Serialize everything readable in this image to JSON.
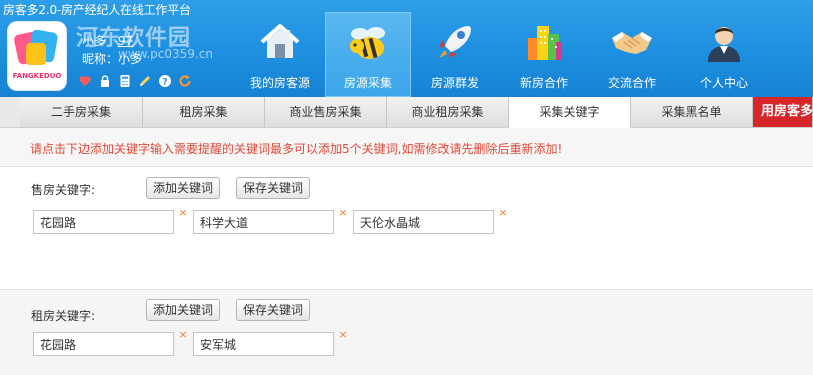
{
  "window_title": "房客多2.0-房产经纪人在线工作平台",
  "logo_text": "FANGKEDUO",
  "watermark": "河东软件园",
  "watermark_url": "www.pc0359.cn",
  "user": {
    "name": "小多",
    "id_link": "97",
    "nickname_label": "昵称：",
    "nickname": "小多"
  },
  "mini_icons": [
    "heart-icon",
    "lock-icon",
    "calculator-icon",
    "pencil-icon",
    "help-icon",
    "refresh-icon"
  ],
  "nav": [
    {
      "label": "我的房客源",
      "icon": "house-icon",
      "active": false
    },
    {
      "label": "房源采集",
      "icon": "bee-icon",
      "active": true
    },
    {
      "label": "房源群发",
      "icon": "rocket-icon",
      "active": false
    },
    {
      "label": "新房合作",
      "icon": "buildings-icon",
      "active": false
    },
    {
      "label": "交流合作",
      "icon": "handshake-icon",
      "active": false
    },
    {
      "label": "个人中心",
      "icon": "person-icon",
      "active": false
    }
  ],
  "tabs": [
    "二手房采集",
    "租房采集",
    "商业售房采集",
    "商业租房采集",
    "采集关键字",
    "采集黑名单",
    "用房客多"
  ],
  "active_tab": "采集关键字",
  "notice": "请点击下边添加关键字输入需要提醒的关键词最多可以添加5个关键词,如需修改请先删除后重新添加!",
  "sale": {
    "label": "售房关键字:",
    "add_button": "添加关键词",
    "save_button": "保存关键词",
    "keywords": [
      "花园路",
      "科学大道",
      "天伦水晶城"
    ]
  },
  "rent": {
    "label": "租房关键字:",
    "add_button": "添加关键词",
    "save_button": "保存关键词",
    "keywords": [
      "花园路",
      "安军城"
    ]
  },
  "delete_glyph": "×",
  "colors": {
    "header_blue": "#1e8fe0",
    "notice_red": "#e04a3a",
    "promo_red": "#d6262a",
    "delete_orange": "#e8853a"
  }
}
